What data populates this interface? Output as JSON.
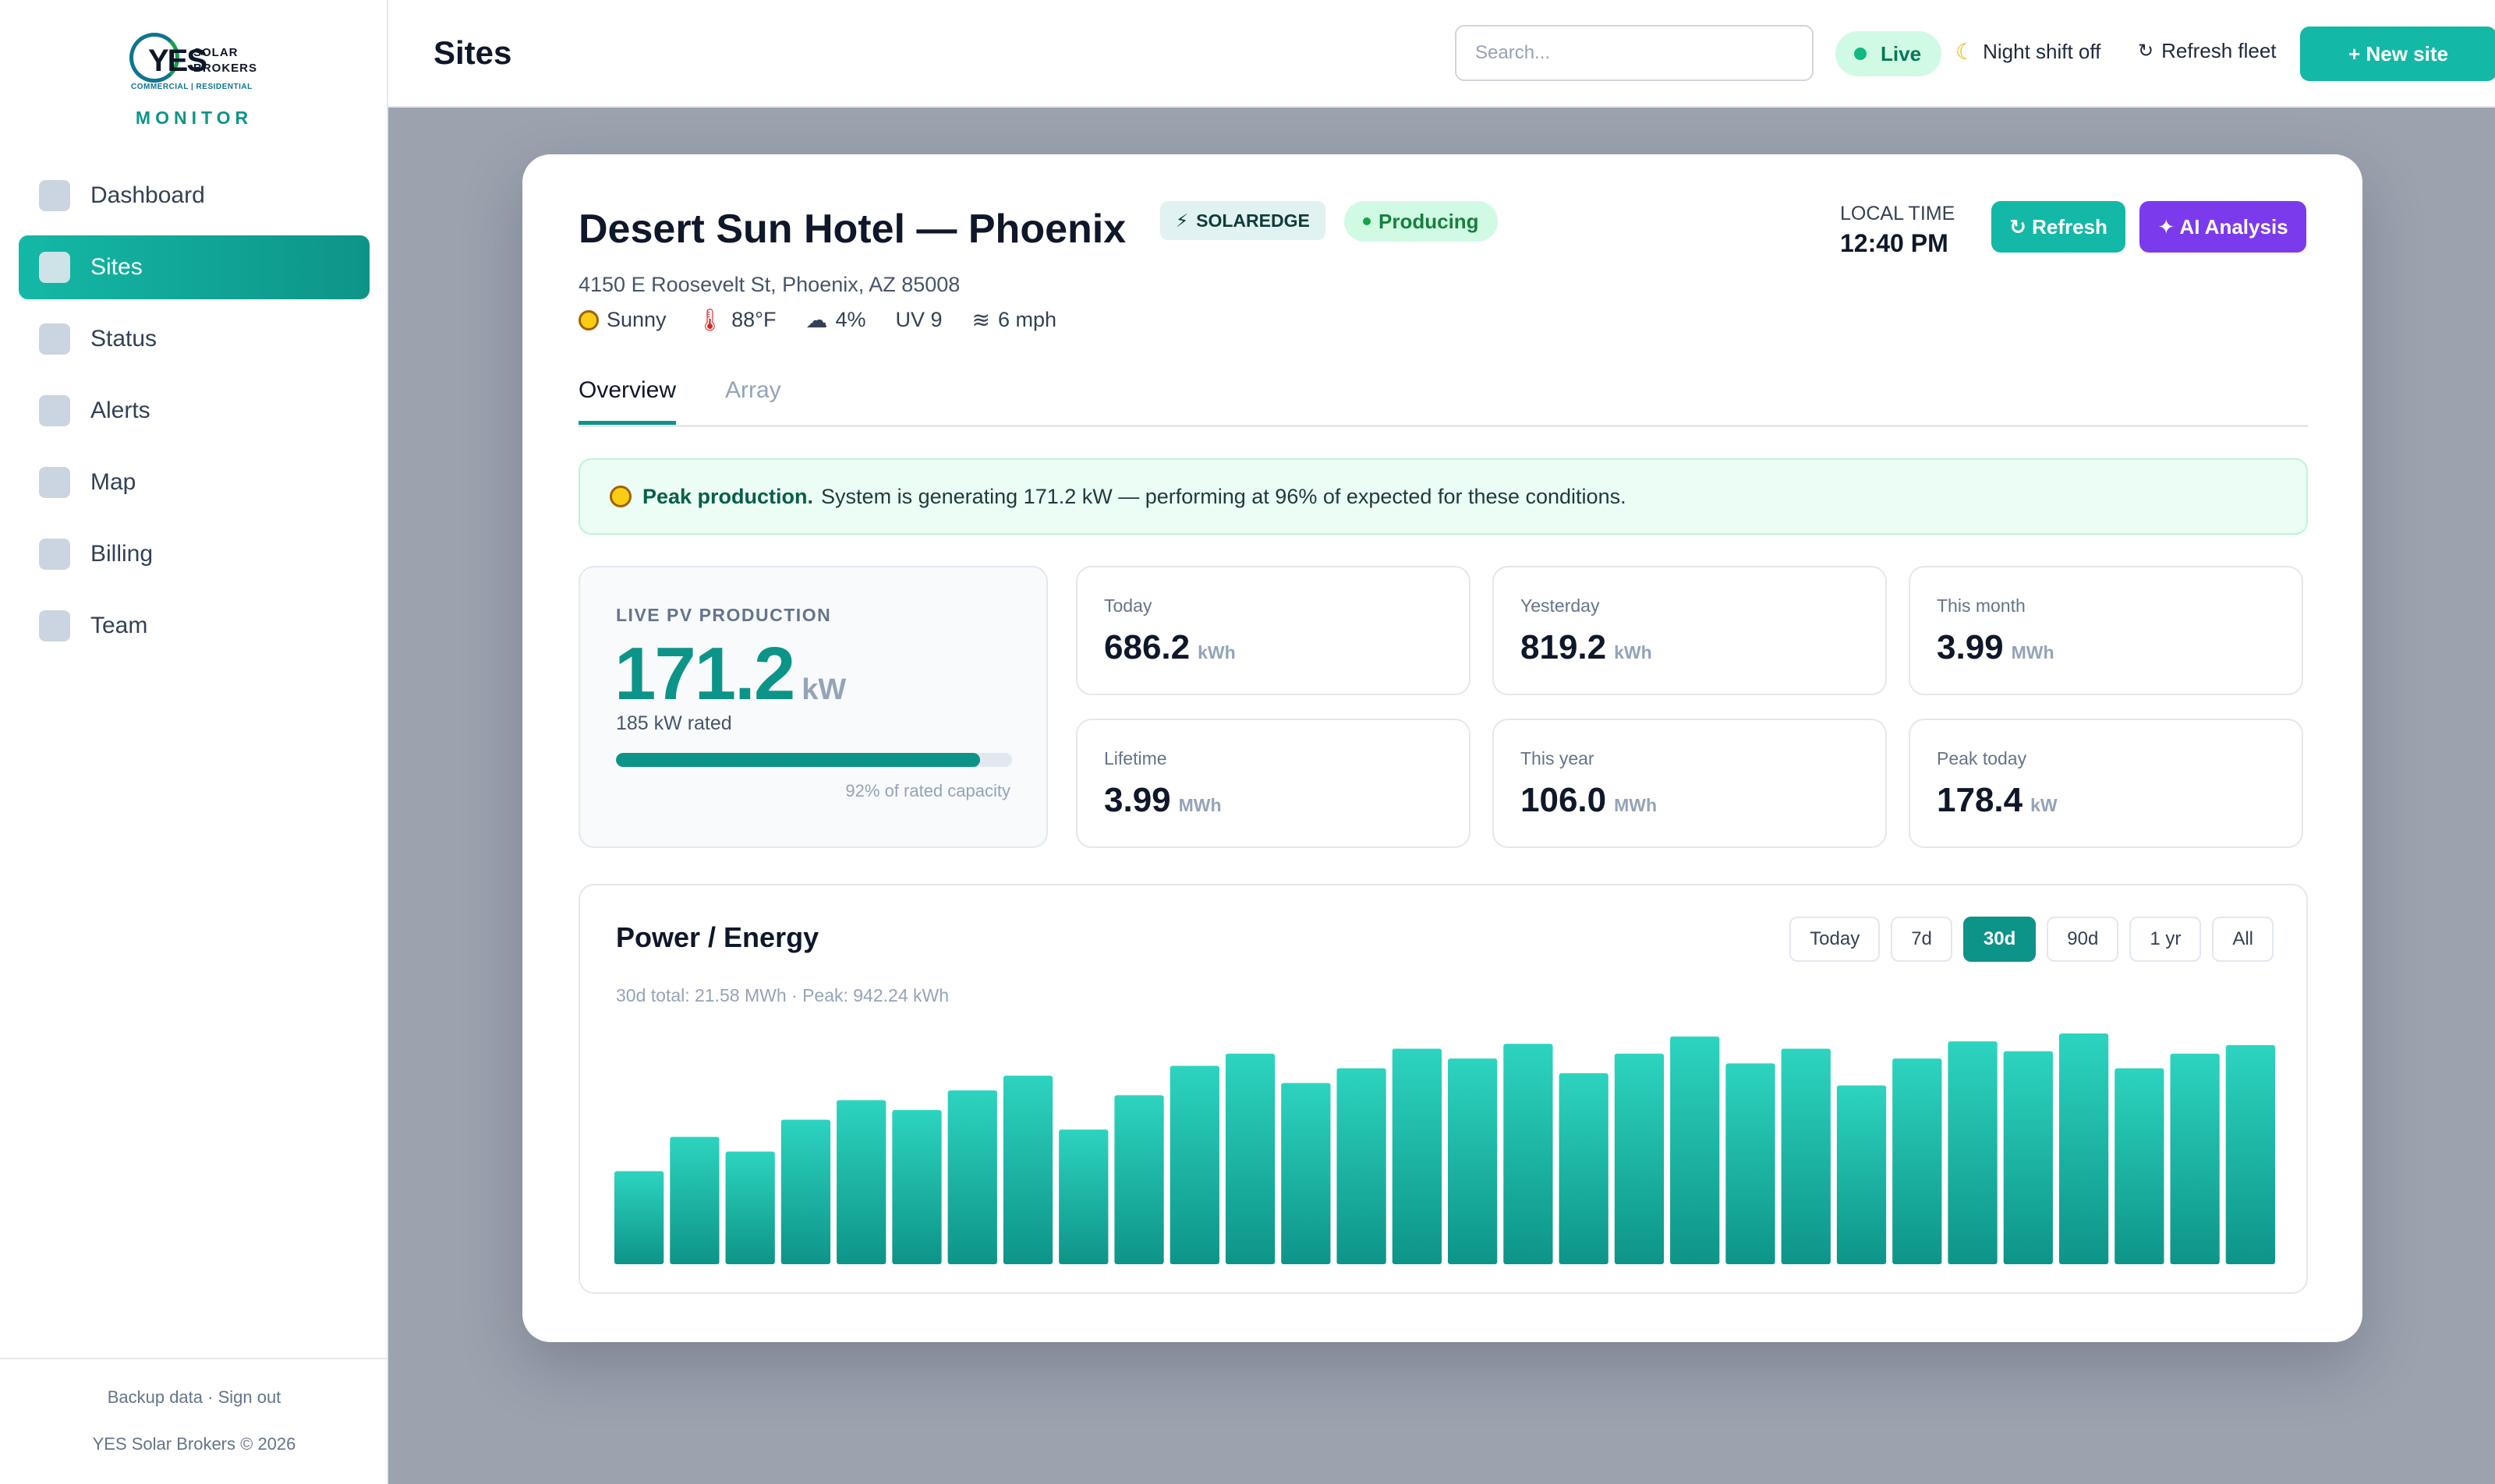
{
  "brand": {
    "logo_yes": "YES",
    "logo_solar_brokers": "SOLAR BROKERS",
    "logo_tag": "COMMERCIAL | RESIDENTIAL",
    "product": "MONITOR"
  },
  "sidebar": {
    "items": [
      {
        "label": "Dashboard"
      },
      {
        "label": "Sites"
      },
      {
        "label": "Status"
      },
      {
        "label": "Alerts"
      },
      {
        "label": "Map"
      },
      {
        "label": "Billing"
      },
      {
        "label": "Team"
      }
    ],
    "active": "Sites",
    "footer_links": "Backup data · Sign out",
    "copyright": "YES Solar Brokers © 2026"
  },
  "topbar": {
    "title": "Sites",
    "search_placeholder": "Search...",
    "live_label": "Live",
    "night_shift": "Night shift off",
    "refresh_fleet": "Refresh fleet",
    "new_site": "+ New site"
  },
  "site": {
    "name": "Desert Sun Hotel — Phoenix",
    "provider_badge": "SOLAREDGE",
    "status_badge": "Producing",
    "local_time_label": "LOCAL TIME",
    "local_time": "12:40 PM",
    "refresh_label": "↻ Refresh",
    "ai_label": "✦ AI Analysis",
    "address": "4150 E Roosevelt St, Phoenix, AZ 85008",
    "weather": {
      "condition": "Sunny",
      "temp": "88°F",
      "cloud": "4%",
      "uv": "UV 9",
      "wind": "6 mph"
    }
  },
  "tabs": {
    "overview": "Overview",
    "array": "Array",
    "active": "Overview"
  },
  "alert": {
    "title": "Peak production.",
    "message": "System is generating 171.2 kW — performing at 96% of expected for these conditions."
  },
  "live": {
    "label": "LIVE PV PRODUCTION",
    "value": "171.2",
    "unit": "kW",
    "rated": "185 kW rated",
    "capacity_pct": 92,
    "capacity_text": "92% of rated capacity"
  },
  "stats": [
    {
      "label": "Today",
      "value": "686.2",
      "unit": "kWh"
    },
    {
      "label": "Yesterday",
      "value": "819.2",
      "unit": "kWh"
    },
    {
      "label": "This month",
      "value": "3.99",
      "unit": "MWh"
    },
    {
      "label": "Lifetime",
      "value": "3.99",
      "unit": "MWh"
    },
    {
      "label": "This year",
      "value": "106.0",
      "unit": "MWh"
    },
    {
      "label": "Peak today",
      "value": "178.4",
      "unit": "kW"
    }
  ],
  "chart": {
    "title": "Power / Energy",
    "subtitle": "30d total: 21.58 MWh · Peak: 942.24 kWh",
    "ranges": [
      "Today",
      "7d",
      "30d",
      "90d",
      "1 yr",
      "All"
    ],
    "selected_range": "30d"
  },
  "chart_data": {
    "type": "bar",
    "ylabel": "",
    "xlabel": "",
    "values": [
      380,
      520,
      460,
      590,
      670,
      630,
      710,
      770,
      550,
      690,
      810,
      860,
      740,
      800,
      880,
      840,
      900,
      780,
      860,
      930,
      820,
      880,
      730,
      840,
      910,
      870,
      942.24,
      800,
      860,
      895
    ],
    "ylim": [
      0,
      942.24
    ]
  },
  "colors": {
    "accent": "#0d9488",
    "bar_top": "#2dd4bf",
    "bar_bottom": "#0d9488",
    "ai": "#7c3aed"
  }
}
